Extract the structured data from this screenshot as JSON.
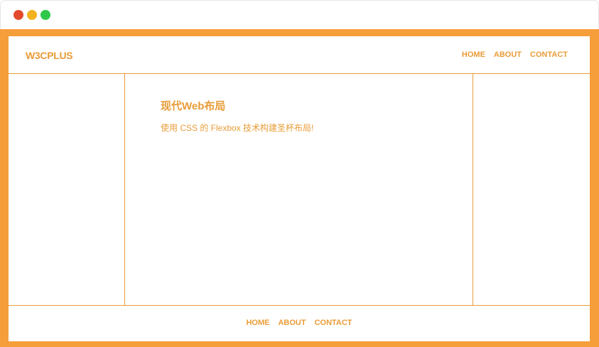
{
  "colors": {
    "accent": "#f59e3a",
    "text_orange": "#e99c38",
    "dot_red": "#e24a2b",
    "dot_yellow": "#f5b21f",
    "dot_green": "#2fc84a"
  },
  "header": {
    "logo": "W3CPLUS",
    "nav": [
      "HOME",
      "ABOUT",
      "CONTACT"
    ]
  },
  "content": {
    "title": "现代Web布局",
    "subtitle": "使用 CSS 的 Flexbox 技术构建圣杯布局!"
  },
  "footer": {
    "nav": [
      "HOME",
      "ABOUT",
      "CONTACT"
    ]
  }
}
